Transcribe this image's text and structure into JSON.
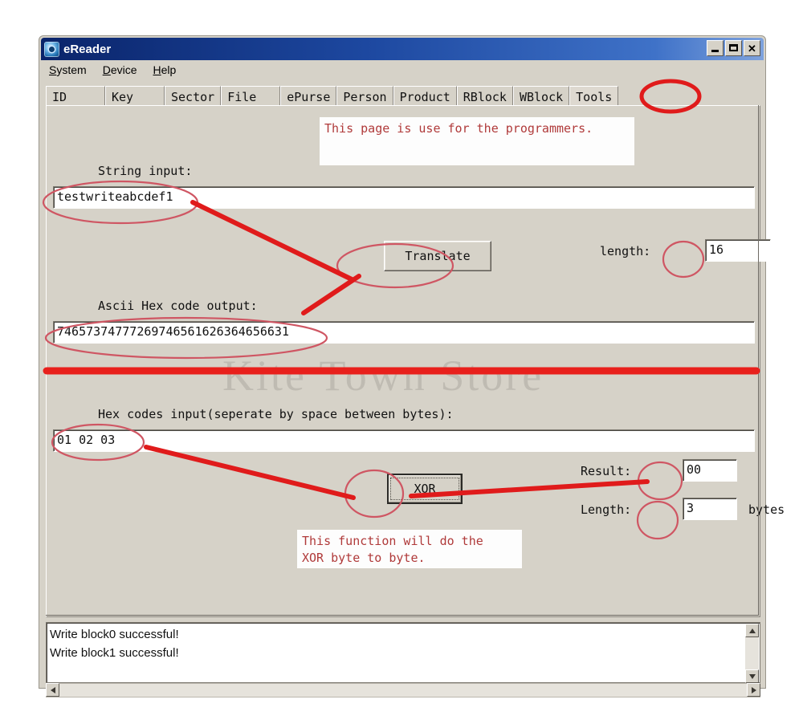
{
  "window": {
    "title": "eReader",
    "icon": "app-globe-icon",
    "controls": {
      "minimize": "_",
      "maximize": "□",
      "close": "✕"
    }
  },
  "menubar": {
    "items": [
      {
        "label": "System",
        "mnemonic": "S"
      },
      {
        "label": "Device",
        "mnemonic": "D"
      },
      {
        "label": "Help",
        "mnemonic": "H"
      }
    ]
  },
  "tabs": {
    "active": "Tools",
    "items": [
      {
        "label": "ID"
      },
      {
        "label": "Key"
      },
      {
        "label": "Sector"
      },
      {
        "label": "File"
      },
      {
        "label": "ePurse"
      },
      {
        "label": "Person"
      },
      {
        "label": "Product"
      },
      {
        "label": "RBlock"
      },
      {
        "label": "WBlock"
      },
      {
        "label": "Tools"
      }
    ]
  },
  "tools_page": {
    "note_top": "This page is use for the programmers.",
    "string_input_label": "String input:",
    "string_input_value": "testwriteabcdef1",
    "translate_button": "Translate",
    "length_label": "length:",
    "length_value": "16",
    "ascii_hex_label": "Ascii Hex code output:",
    "ascii_hex_value": "74657374777269746561626364656631",
    "hex_input_label": "Hex codes input(seperate by space between bytes):",
    "hex_input_value": "01 02 03",
    "xor_button": "XOR",
    "result_label": "Result:",
    "result_value": "00",
    "xor_length_label": "Length:",
    "xor_length_value": "3",
    "bytes_unit": "bytes",
    "note_bottom": "This function will do the\nXOR byte to byte."
  },
  "log": {
    "lines": "Write block0 successful!\nWrite block1 successful!"
  },
  "watermark": {
    "text": "Kite Town Store"
  },
  "annotations": {
    "color": "#e01b1b",
    "highlight_color": "#c0505c",
    "items": [
      {
        "name": "circle-tools-tab",
        "target": "Tools"
      },
      {
        "name": "circle-string-input-value",
        "target": "testwriteabcdef1"
      },
      {
        "name": "circle-translate-button",
        "target": "Translate"
      },
      {
        "name": "circle-length-value",
        "target": "16"
      },
      {
        "name": "circle-ascii-hex-value",
        "target": "74657374777269746561626364656631"
      },
      {
        "name": "circle-hex-input-value",
        "target": "01 02 03"
      },
      {
        "name": "circle-xor-button",
        "target": "XOR"
      },
      {
        "name": "circle-result-value",
        "target": "00"
      },
      {
        "name": "circle-xor-length-value",
        "target": "3"
      },
      {
        "name": "arrow-string-to-translate",
        "target": ""
      },
      {
        "name": "arrow-translate-to-ascii-hex",
        "target": ""
      },
      {
        "name": "arrow-hex-input-to-xor",
        "target": ""
      },
      {
        "name": "arrow-xor-to-result",
        "target": ""
      },
      {
        "name": "divider-red-line",
        "target": ""
      }
    ]
  }
}
